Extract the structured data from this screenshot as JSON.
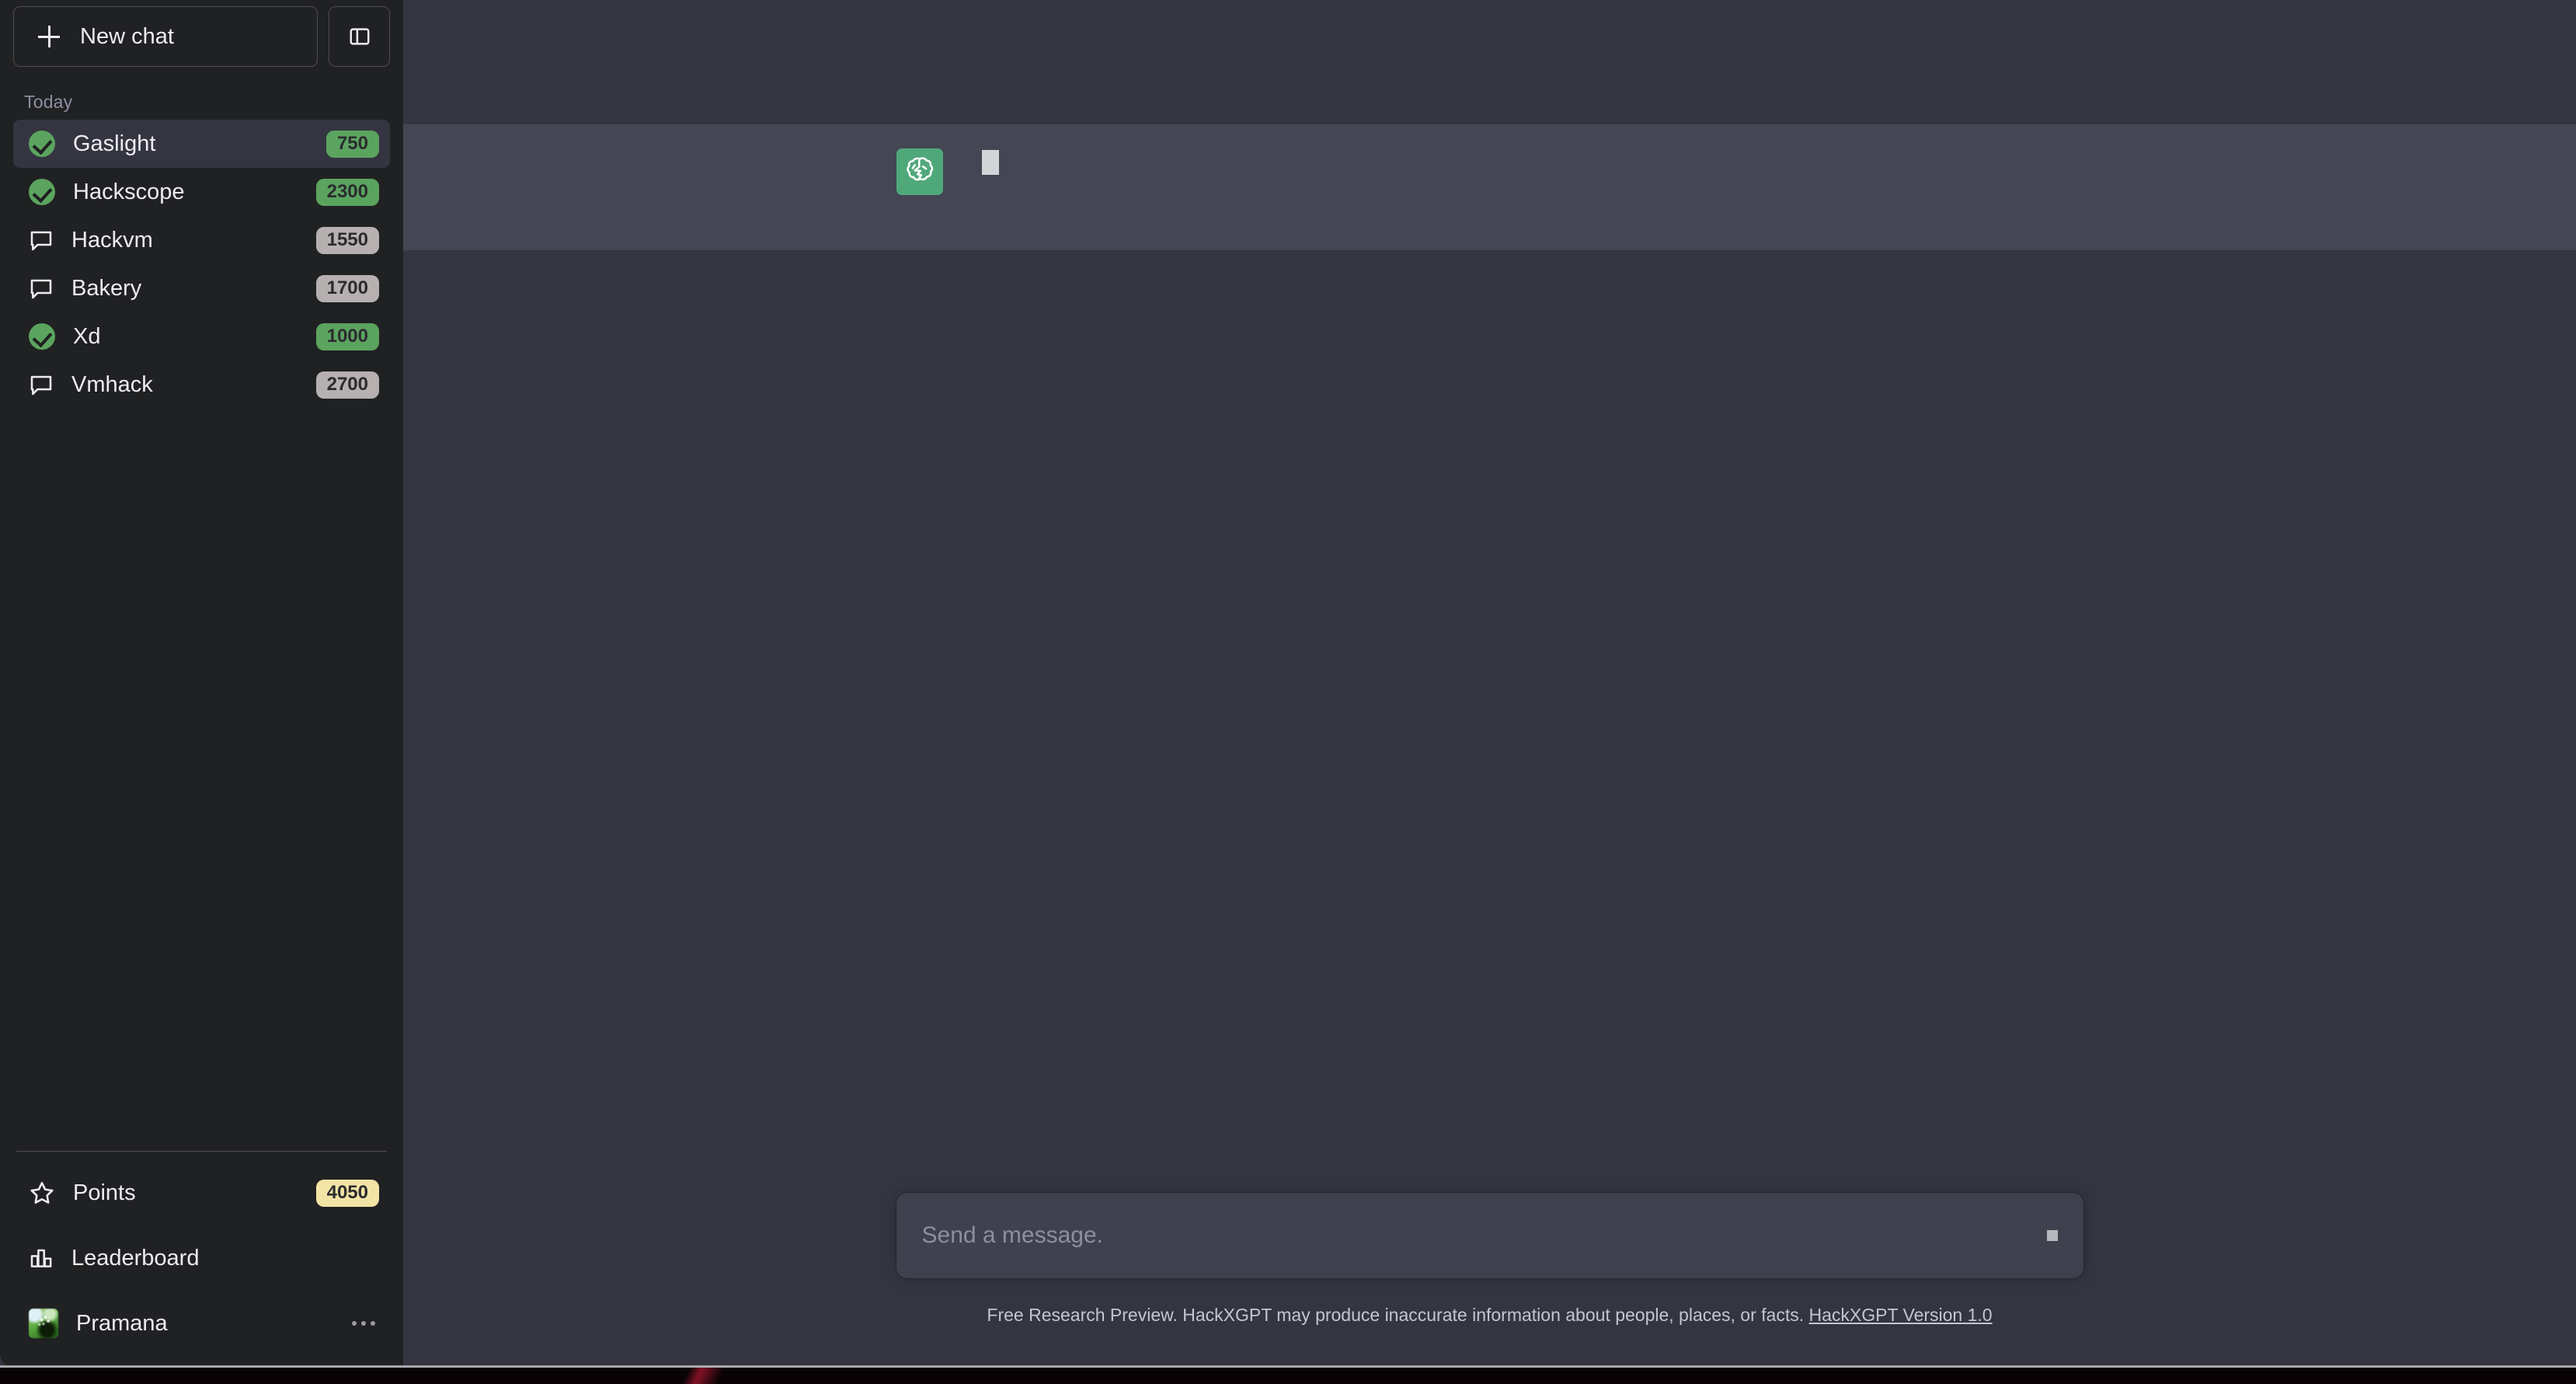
{
  "sidebar": {
    "new_chat_label": "New chat",
    "new_chat_icon": "plus-icon",
    "collapse_icon": "sidebar-toggle-icon",
    "section_label": "Today",
    "chats": [
      {
        "label": "Gaslight",
        "badge": "750",
        "badge_color": "green",
        "icon": "check-circle-icon",
        "state": "complete",
        "active": true
      },
      {
        "label": "Hackscope",
        "badge": "2300",
        "badge_color": "green",
        "icon": "check-circle-icon",
        "state": "complete",
        "active": false
      },
      {
        "label": "Hackvm",
        "badge": "1550",
        "badge_color": "gray",
        "icon": "chat-bubble-icon",
        "state": "pending",
        "active": false
      },
      {
        "label": "Bakery",
        "badge": "1700",
        "badge_color": "gray",
        "icon": "chat-bubble-icon",
        "state": "pending",
        "active": false
      },
      {
        "label": "Xd",
        "badge": "1000",
        "badge_color": "green",
        "icon": "check-circle-icon",
        "state": "complete",
        "active": false
      },
      {
        "label": "Vmhack",
        "badge": "2700",
        "badge_color": "gray",
        "icon": "chat-bubble-icon",
        "state": "pending",
        "active": false
      }
    ],
    "points": {
      "label": "Points",
      "badge": "4050",
      "badge_color": "yellow",
      "icon": "star-icon"
    },
    "leaderboard": {
      "label": "Leaderboard",
      "icon": "bar-chart-icon"
    },
    "account": {
      "label": "Pramana",
      "icon": "user-avatar",
      "menu_icon": "ellipsis-icon"
    }
  },
  "colors": {
    "sidebar_bg": "#202123",
    "main_bg": "#343541",
    "assistant_row_bg": "#444654",
    "accent_green": "#5ba45f",
    "bot_avatar_green": "#4fa87a",
    "badge_gray": "#b6b0b0",
    "badge_yellow": "#f2e4a4",
    "composer_bg": "#40414f",
    "muted_text": "#8e8ea0"
  },
  "thread": {
    "messages": [
      {
        "role": "user",
        "avatar": "user-avatar",
        "text": ""
      },
      {
        "role": "assistant",
        "avatar": "hackxgpt-logo-icon",
        "text": ""
      }
    ]
  },
  "composer": {
    "placeholder": "Send a message.",
    "value": "",
    "send_icon": "send-icon"
  },
  "footer": {
    "disclaimer": "Free Research Preview. HackXGPT may produce inaccurate information about people, places, or facts.",
    "version_link": "HackXGPT Version 1.0"
  }
}
